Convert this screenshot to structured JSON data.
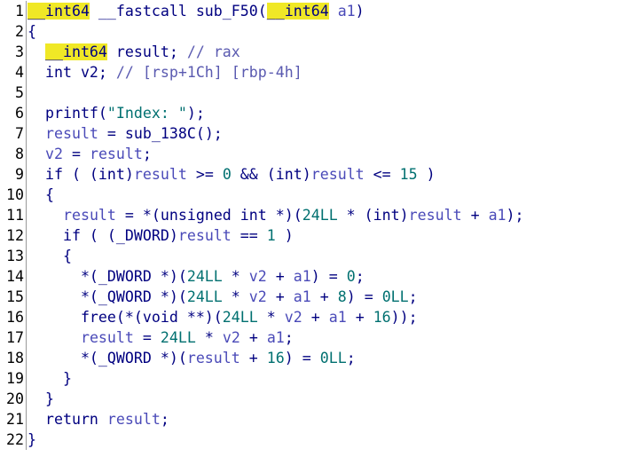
{
  "colors": {
    "background": "#ffffff",
    "code_default": "#000080",
    "variable": "#4a4ab8",
    "number": "#007070",
    "string": "#007070",
    "comment": "#5a5ab0",
    "highlight": "#f0e826",
    "gutter_text": "#000000",
    "gutter_separator": "#9a9a9a"
  },
  "lines": [
    {
      "num": "1",
      "tokens": [
        {
          "text": "__int64",
          "cls": "hl"
        },
        {
          "text": " __fastcall sub_F50(",
          "cls": "default"
        },
        {
          "text": "__int64",
          "cls": "hl"
        },
        {
          "text": " ",
          "cls": "default"
        },
        {
          "text": "a1",
          "cls": "var"
        },
        {
          "text": ")",
          "cls": "default"
        }
      ]
    },
    {
      "num": "2",
      "tokens": [
        {
          "text": "{",
          "cls": "default"
        }
      ]
    },
    {
      "num": "3",
      "tokens": [
        {
          "text": "  ",
          "cls": "default"
        },
        {
          "text": "__int64",
          "cls": "hl"
        },
        {
          "text": " result; ",
          "cls": "default"
        },
        {
          "text": "// rax",
          "cls": "comment"
        }
      ]
    },
    {
      "num": "4",
      "tokens": [
        {
          "text": "  int v2; ",
          "cls": "default"
        },
        {
          "text": "// [rsp+1Ch] [rbp-4h]",
          "cls": "comment"
        }
      ]
    },
    {
      "num": "5",
      "tokens": []
    },
    {
      "num": "6",
      "tokens": [
        {
          "text": "  printf(",
          "cls": "default"
        },
        {
          "text": "\"Index: \"",
          "cls": "str"
        },
        {
          "text": ");",
          "cls": "default"
        }
      ]
    },
    {
      "num": "7",
      "tokens": [
        {
          "text": "  ",
          "cls": "default"
        },
        {
          "text": "result",
          "cls": "var"
        },
        {
          "text": " = sub_138C();",
          "cls": "default"
        }
      ]
    },
    {
      "num": "8",
      "tokens": [
        {
          "text": "  ",
          "cls": "default"
        },
        {
          "text": "v2",
          "cls": "var"
        },
        {
          "text": " = ",
          "cls": "default"
        },
        {
          "text": "result",
          "cls": "var"
        },
        {
          "text": ";",
          "cls": "default"
        }
      ]
    },
    {
      "num": "9",
      "tokens": [
        {
          "text": "  if ( (int)",
          "cls": "default"
        },
        {
          "text": "result",
          "cls": "var"
        },
        {
          "text": " >= ",
          "cls": "default"
        },
        {
          "text": "0",
          "cls": "num"
        },
        {
          "text": " && (int)",
          "cls": "default"
        },
        {
          "text": "result",
          "cls": "var"
        },
        {
          "text": " <= ",
          "cls": "default"
        },
        {
          "text": "15",
          "cls": "num"
        },
        {
          "text": " )",
          "cls": "default"
        }
      ]
    },
    {
      "num": "10",
      "tokens": [
        {
          "text": "  {",
          "cls": "default"
        }
      ]
    },
    {
      "num": "11",
      "tokens": [
        {
          "text": "    ",
          "cls": "default"
        },
        {
          "text": "result",
          "cls": "var"
        },
        {
          "text": " = *(unsigned int *)(",
          "cls": "default"
        },
        {
          "text": "24LL",
          "cls": "num"
        },
        {
          "text": " * (int)",
          "cls": "default"
        },
        {
          "text": "result",
          "cls": "var"
        },
        {
          "text": " + ",
          "cls": "default"
        },
        {
          "text": "a1",
          "cls": "var"
        },
        {
          "text": ");",
          "cls": "default"
        }
      ]
    },
    {
      "num": "12",
      "tokens": [
        {
          "text": "    if ( (_DWORD)",
          "cls": "default"
        },
        {
          "text": "result",
          "cls": "var"
        },
        {
          "text": " == ",
          "cls": "default"
        },
        {
          "text": "1",
          "cls": "num"
        },
        {
          "text": " )",
          "cls": "default"
        }
      ]
    },
    {
      "num": "13",
      "tokens": [
        {
          "text": "    {",
          "cls": "default"
        }
      ]
    },
    {
      "num": "14",
      "tokens": [
        {
          "text": "      *(_DWORD *)(",
          "cls": "default"
        },
        {
          "text": "24LL",
          "cls": "num"
        },
        {
          "text": " * ",
          "cls": "default"
        },
        {
          "text": "v2",
          "cls": "var"
        },
        {
          "text": " + ",
          "cls": "default"
        },
        {
          "text": "a1",
          "cls": "var"
        },
        {
          "text": ") = ",
          "cls": "default"
        },
        {
          "text": "0",
          "cls": "num"
        },
        {
          "text": ";",
          "cls": "default"
        }
      ]
    },
    {
      "num": "15",
      "tokens": [
        {
          "text": "      *(_QWORD *)(",
          "cls": "default"
        },
        {
          "text": "24LL",
          "cls": "num"
        },
        {
          "text": " * ",
          "cls": "default"
        },
        {
          "text": "v2",
          "cls": "var"
        },
        {
          "text": " + ",
          "cls": "default"
        },
        {
          "text": "a1",
          "cls": "var"
        },
        {
          "text": " + ",
          "cls": "default"
        },
        {
          "text": "8",
          "cls": "num"
        },
        {
          "text": ") = ",
          "cls": "default"
        },
        {
          "text": "0LL",
          "cls": "num"
        },
        {
          "text": ";",
          "cls": "default"
        }
      ]
    },
    {
      "num": "16",
      "tokens": [
        {
          "text": "      free(*(void **)(",
          "cls": "default"
        },
        {
          "text": "24LL",
          "cls": "num"
        },
        {
          "text": " * ",
          "cls": "default"
        },
        {
          "text": "v2",
          "cls": "var"
        },
        {
          "text": " + ",
          "cls": "default"
        },
        {
          "text": "a1",
          "cls": "var"
        },
        {
          "text": " + ",
          "cls": "default"
        },
        {
          "text": "16",
          "cls": "num"
        },
        {
          "text": "));",
          "cls": "default"
        }
      ]
    },
    {
      "num": "17",
      "tokens": [
        {
          "text": "      ",
          "cls": "default"
        },
        {
          "text": "result",
          "cls": "var"
        },
        {
          "text": " = ",
          "cls": "default"
        },
        {
          "text": "24LL",
          "cls": "num"
        },
        {
          "text": " * ",
          "cls": "default"
        },
        {
          "text": "v2",
          "cls": "var"
        },
        {
          "text": " + ",
          "cls": "default"
        },
        {
          "text": "a1",
          "cls": "var"
        },
        {
          "text": ";",
          "cls": "default"
        }
      ]
    },
    {
      "num": "18",
      "tokens": [
        {
          "text": "      *(_QWORD *)(",
          "cls": "default"
        },
        {
          "text": "result",
          "cls": "var"
        },
        {
          "text": " + ",
          "cls": "default"
        },
        {
          "text": "16",
          "cls": "num"
        },
        {
          "text": ") = ",
          "cls": "default"
        },
        {
          "text": "0LL",
          "cls": "num"
        },
        {
          "text": ";",
          "cls": "default"
        }
      ]
    },
    {
      "num": "19",
      "tokens": [
        {
          "text": "    }",
          "cls": "default"
        }
      ]
    },
    {
      "num": "20",
      "tokens": [
        {
          "text": "  }",
          "cls": "default"
        }
      ]
    },
    {
      "num": "21",
      "tokens": [
        {
          "text": "  return ",
          "cls": "default"
        },
        {
          "text": "result",
          "cls": "var"
        },
        {
          "text": ";",
          "cls": "default"
        }
      ]
    },
    {
      "num": "22",
      "tokens": [
        {
          "text": "}",
          "cls": "default"
        }
      ]
    }
  ]
}
